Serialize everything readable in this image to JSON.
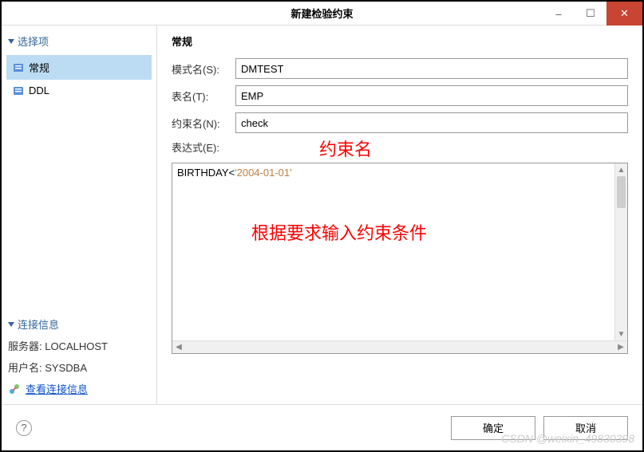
{
  "title": "新建检验约束",
  "sidebar": {
    "section": "选择项",
    "items": [
      {
        "label": "常规",
        "icon": "props-icon"
      },
      {
        "label": "DDL",
        "icon": "props-icon"
      }
    ]
  },
  "connection": {
    "section": "连接信息",
    "server_label": "服务器:",
    "server_value": "LOCALHOST",
    "user_label": "用户名:",
    "user_value": "SYSDBA",
    "link": "查看连接信息"
  },
  "content": {
    "heading": "常规",
    "schema_label": "模式名(S):",
    "schema_value": "DMTEST",
    "table_label": "表名(T):",
    "table_value": "EMP",
    "constraint_label": "约束名(N):",
    "constraint_value": "check",
    "expression_label": "表达式(E):",
    "expression_code_prefix": "BIRTHDAY<",
    "expression_code_str": "'2004-01-01'"
  },
  "annotations": {
    "constraint_name": "约束名",
    "expression_hint": "根据要求输入约束条件"
  },
  "footer": {
    "ok": "确定",
    "cancel": "取消"
  },
  "watermark": "CSDN @weixin_49830398"
}
